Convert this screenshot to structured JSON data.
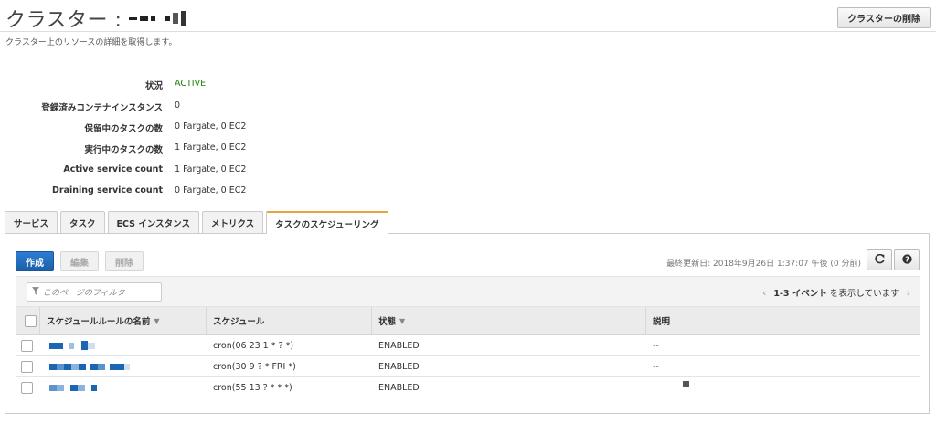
{
  "header": {
    "title": "クラスター :",
    "delete_label": "クラスターの削除",
    "description": "クラスター上のリソースの詳細を取得します。"
  },
  "details": [
    {
      "label": "状況",
      "value": "ACTIVE"
    },
    {
      "label": "登録済みコンテナインスタンス",
      "value": "0"
    },
    {
      "label": "保留中のタスクの数",
      "value": "0 Fargate, 0 EC2"
    },
    {
      "label": "実行中のタスクの数",
      "value": "1 Fargate, 0 EC2"
    },
    {
      "label": "Active service count",
      "value": "1 Fargate, 0 EC2"
    },
    {
      "label": "Draining service count",
      "value": "0 Fargate, 0 EC2"
    }
  ],
  "tabs": [
    {
      "label": "サービス"
    },
    {
      "label": "タスク"
    },
    {
      "label": "ECS インスタンス"
    },
    {
      "label": "メトリクス"
    },
    {
      "label": "タスクのスケジューリング"
    }
  ],
  "toolbar": {
    "create_label": "作成",
    "edit_label": "編集",
    "delete_label": "削除",
    "last_updated": "最終更新日: 2018年9月26日 1:37:07 午後 (0 分前)"
  },
  "filter": {
    "placeholder": "このページのフィルター",
    "pager_text": "1-3 イベント",
    "pager_suffix": "を表示しています"
  },
  "table": {
    "columns": [
      "スケジュールルールの名前",
      "スケジュール",
      "状態",
      "説明"
    ],
    "rows": [
      {
        "schedule": "cron(06 23 1 * ? *)",
        "state": "ENABLED",
        "description": "--"
      },
      {
        "schedule": "cron(30 9 ? * FRI *)",
        "state": "ENABLED",
        "description": "--"
      },
      {
        "schedule": "cron(55 13 ? * * *)",
        "state": "ENABLED",
        "description": ""
      }
    ]
  },
  "colors": {
    "status_active": "#1d8102",
    "primary_button": "#1b5fa8",
    "active_tab_accent": "#e7a33e",
    "link_redacted": "#1a66b3"
  },
  "icons": [
    "refresh-icon",
    "help-icon",
    "filter-icon",
    "sort-down-icon",
    "chevron-left-icon",
    "chevron-right-icon"
  ]
}
